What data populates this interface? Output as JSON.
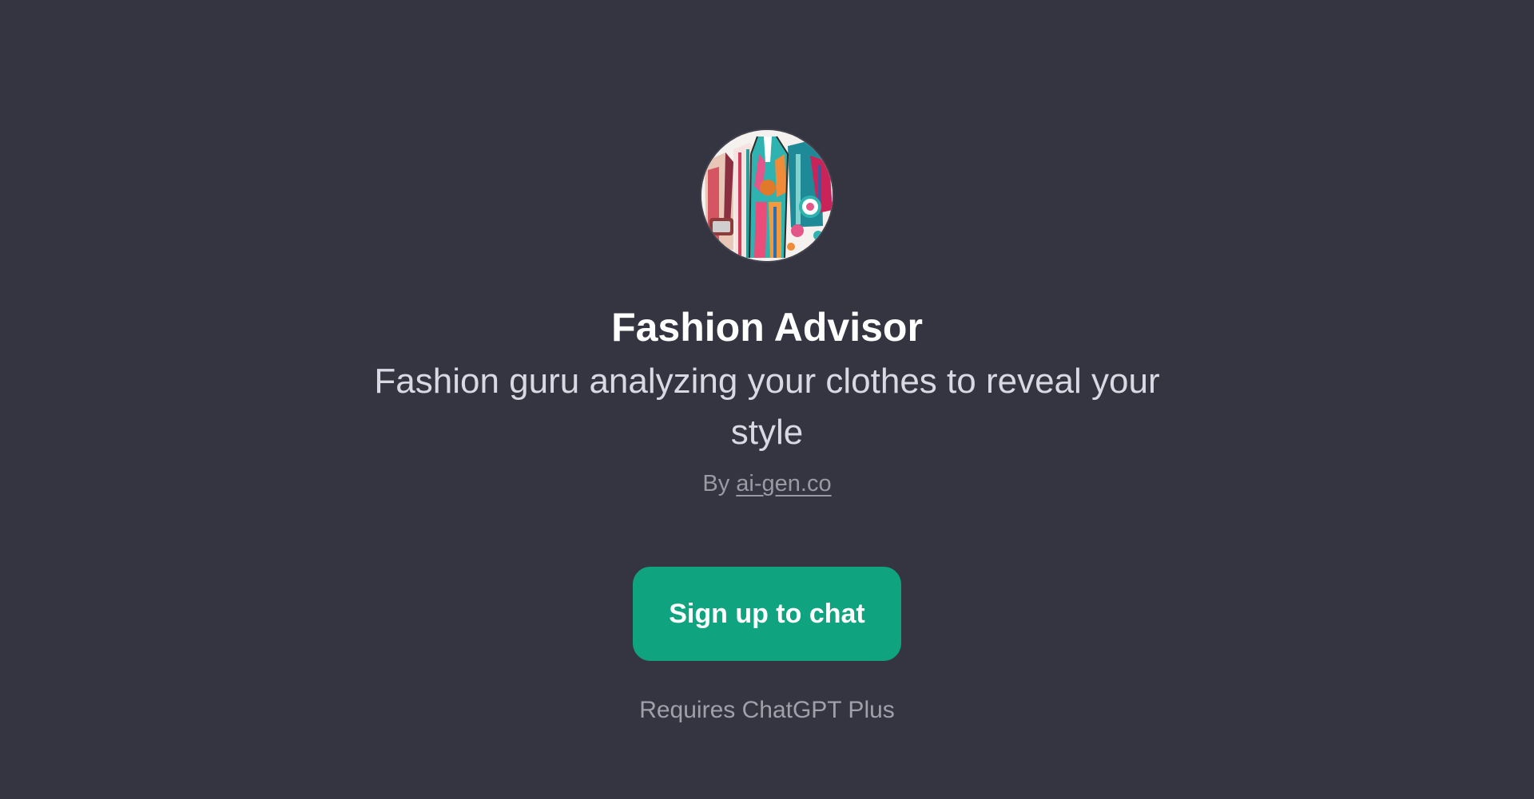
{
  "gpt": {
    "name": "Fashion Advisor",
    "description": "Fashion guru analyzing your clothes to reveal your style",
    "by_prefix": "By",
    "author": "ai-gen.co",
    "avatar_icon": "fashion-clothes-illustration"
  },
  "actions": {
    "signup_label": "Sign up to chat",
    "requirement": "Requires ChatGPT Plus"
  },
  "colors": {
    "background": "#343541",
    "accent": "#10a37f",
    "title": "#ffffff",
    "subtitle": "#d9d9e3",
    "muted": "#9a9aa5"
  }
}
